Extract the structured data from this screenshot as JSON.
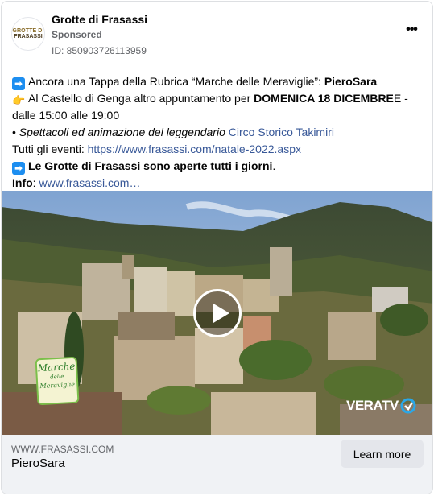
{
  "post": {
    "page_name": "Grotte di Frasassi",
    "sponsored_label": "Sponsored",
    "ad_id": "ID: 850903726113959",
    "avatar": {
      "line1": "GROTTE DI",
      "line2": "FRASASSI"
    },
    "more_glyph": "•••"
  },
  "body": {
    "line1_pre": "Ancora una Tappa della Rubrica “Marche delle Meraviglie”: ",
    "line1_bold": "PieroSara",
    "line2_pre": "Al Castello di Genga altro appuntamento per ",
    "line2_bold": "DOMENICA 18 DICEMBRE",
    "line2_post": "E -",
    "line3": "dalle 15:00 alle 19:00",
    "line4_pre": "• ",
    "line4_ital": "Spettacoli ed animazione del leggendario ",
    "line4_link": "Circo Storico Takimiri",
    "line5_pre": "Tutti gli eventi: ",
    "line5_link": "https://www.frasassi.com/natale-2022.aspx",
    "line6_bold": "Le Grotte di Frasassi sono aperte tutti i giorni",
    "line6_post": ".",
    "line7_bold": "Info",
    "line7_pre": ": ",
    "line7_link": "www.frasassi.com…",
    "arrow_glyph": "➡",
    "hand_glyph": "👉"
  },
  "media": {
    "badge": {
      "line1": "Marche",
      "line2": "delle",
      "line3": "Meraviglie"
    },
    "brand": "VERATV",
    "play_icon": "play-icon"
  },
  "footer": {
    "domain": "WWW.FRASASSI.COM",
    "headline": "PieroSara",
    "cta": "Learn more"
  },
  "colors": {
    "link": "#385898",
    "footer_bg": "#f0f2f5",
    "button_bg": "#e4e6eb"
  }
}
